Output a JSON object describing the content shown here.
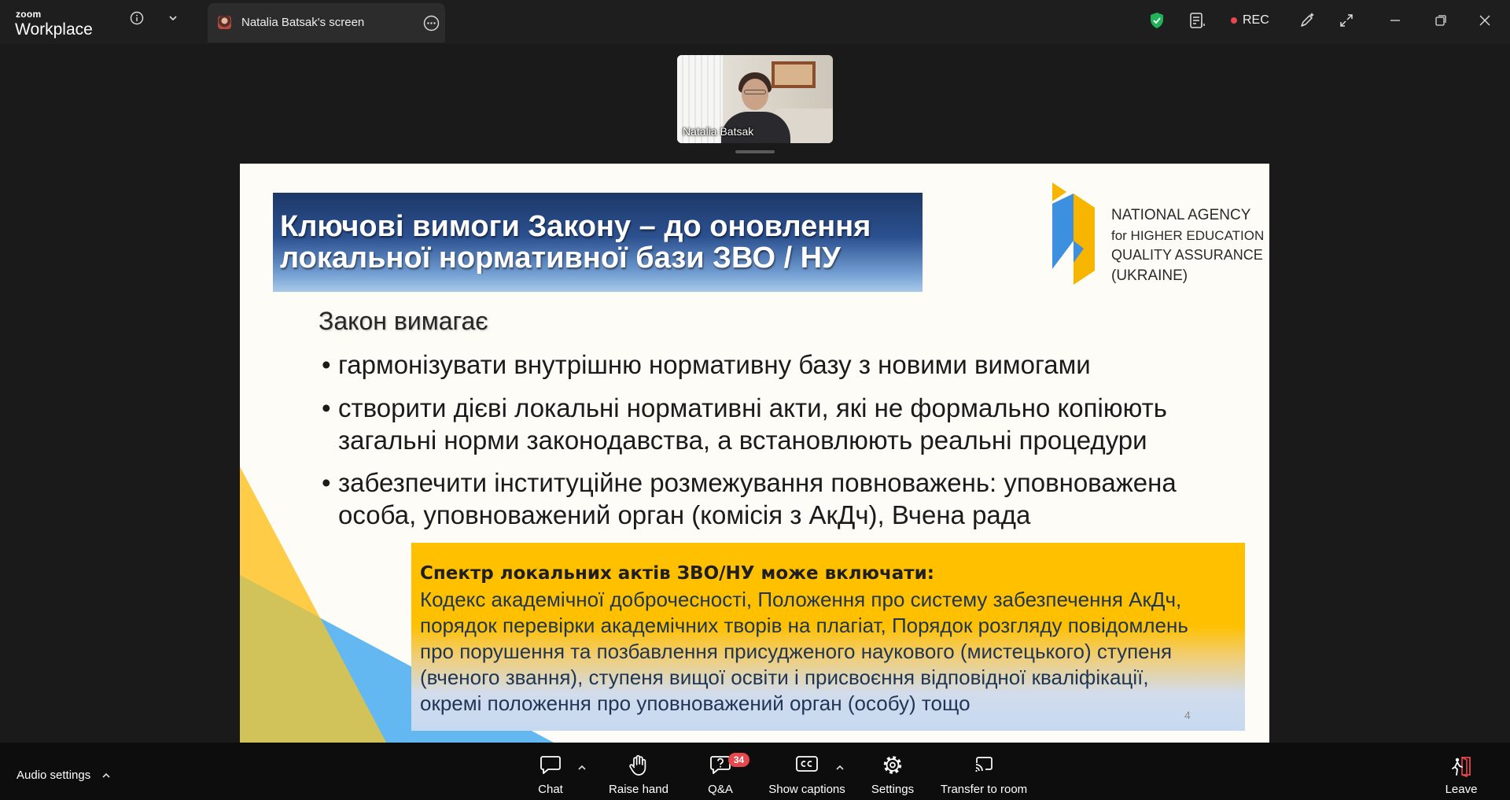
{
  "window": {
    "logo_small": "zoom",
    "logo_large": "Workplace",
    "tab_title": "Natalia Batsak's screen",
    "rec_label": "REC"
  },
  "participant": {
    "name": "Natalia Batsak"
  },
  "slide": {
    "title_lines": [
      "Ключові вимоги Закону – до оновлення",
      "локальної нормативної бази ЗВО / НУ"
    ],
    "logo_lines": [
      "NATIONAL AGENCY",
      "for HIGHER EDUCATION",
      "QUALITY ASSURANCE",
      "(UKRAINE)"
    ],
    "subheading": "Закон вимагає",
    "bullet_char": "•",
    "bullets": [
      {
        "lines": [
          "гармонізувати внутрішню нормативну базу з новими вимогами"
        ]
      },
      {
        "lines": [
          "створити дієві локальні нормативні акти, які не формально копіюють",
          "загальні норми законодавства, а встановлюють реальні процедури"
        ]
      },
      {
        "lines": [
          "забезпечити інституційне розмежування повноважень: уповноважена",
          "особа, уповноважений орган (комісія з АкДч), Вчена рада"
        ]
      }
    ],
    "box": {
      "heading": "Спектр локальних актів ЗВО/НУ може включати:",
      "lines": [
        "Кодекс академічної доброчесності, Положення про систему забезпечення АкДч,",
        "порядок перевірки академічних творів на плагіат, Порядок розгляду повідомлень",
        "про порушення та позбавлення присудженого наукового (мистецького) ступеня",
        "(вченого звання), ступеня вищої освіти і присвоєння відповідної кваліфікації,",
        "окремі положення про уповноважений орган (особу) тощо"
      ]
    },
    "page_number": "4"
  },
  "toolbar": {
    "audio_settings": "Audio settings",
    "chat": "Chat",
    "raise_hand": "Raise hand",
    "qa": "Q&A",
    "qa_badge": "34",
    "show_captions": "Show captions",
    "settings": "Settings",
    "transfer": "Transfer to room",
    "leave": "Leave"
  },
  "icons": {
    "topbar": [
      "info-icon",
      "chevron-down-icon",
      "more-options-icon",
      "security-shield-icon",
      "notes-icon",
      "record-dot-icon",
      "annotate-pen-icon",
      "fullscreen-icon",
      "minimize-icon",
      "restore-icon",
      "close-icon"
    ],
    "toolbar": [
      "caret-up-icon",
      "chat-icon",
      "raise-hand-icon",
      "qa-icon",
      "captions-icon",
      "settings-gear-icon",
      "transfer-room-icon",
      "leave-door-icon"
    ]
  },
  "colors": {
    "rec_dot": "#e5484d",
    "security_shield": "#22b35a",
    "badge": "#e5484d",
    "leave_door": "#e5484d",
    "slide_background": "#fdfcf6",
    "title_gradient_top": "#1d3868",
    "title_gradient_bottom": "#a9c9ea",
    "box_yellow": "#ffc000",
    "box_blue": "#c6d9f1",
    "deco_yellow": "#ffcc47",
    "deco_blue": "#63b8f1",
    "logo_blue": "#3d8fe0",
    "logo_yellow": "#f7b500"
  }
}
